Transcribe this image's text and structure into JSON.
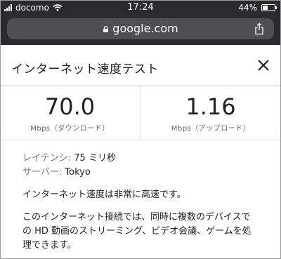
{
  "status_bar": {
    "carrier": "docomo",
    "time": "17:24",
    "battery_text": "44%",
    "battery_level": 0.44,
    "text_color": "#ffffff"
  },
  "browser": {
    "url": "google.com"
  },
  "panel": {
    "title": "インターネット速度テスト",
    "close_icon": "close-icon"
  },
  "speeds": {
    "download_value": "70.0",
    "download_label": "Mbps（ダウンロード）",
    "upload_value": "1.16",
    "upload_label": "Mbps（アップロード）"
  },
  "details": {
    "latency_label": "レイテンシ: ",
    "latency_value": "75 ミリ秒",
    "server_label": "サーバー: ",
    "server_value": "Tokyo",
    "message": "インターネット速度は非常に高速です。",
    "description_line1": "このインターネット接続では、同時に複数のデバイスで",
    "description_line2": "の HD 動画のストリーミング、ビデオ会議、ゲームを処",
    "description_line3": "理できます。"
  },
  "colors": {
    "chrome_dark": "#2b2b2d",
    "url_pill": "#505052",
    "divider": "#dadce0",
    "label_gray": "#70757a"
  }
}
